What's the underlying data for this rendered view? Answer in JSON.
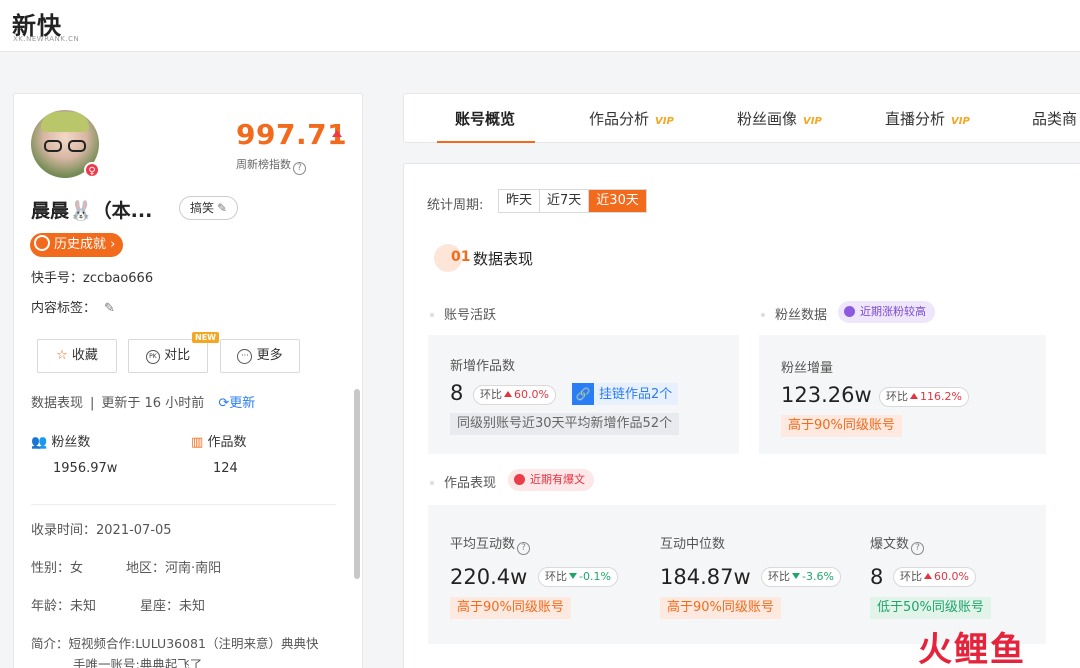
{
  "brand": {
    "logo": "新快",
    "sub": "XK.NEWRANK.CN"
  },
  "profile": {
    "score": "997.71",
    "score_label": "周新榜指数",
    "name": "晨晨🐰（本...",
    "tag": "搞笑",
    "gender": "♀",
    "history_label": "历史成就 ›",
    "kuaishou_id": "快手号：zccbao666",
    "content_tags": "内容标签：",
    "actions": {
      "collect": "收藏",
      "compare": "对比",
      "more": "更多",
      "new_badge": "NEW"
    },
    "data_perf": "数据表现",
    "updated": "更新于 16 小时前",
    "refresh": "更新",
    "fans_label": "粉丝数",
    "fans_value": "1956.97w",
    "works_label": "作品数",
    "works_value": "124",
    "indexed": "收录时间：2021-07-05",
    "gender_line": "性别：女",
    "region": "地区：河南·南阳",
    "age": "年龄：未知",
    "constellation": "星座：未知",
    "intro_1": "简介：短视频合作:LULU36081（注明来意）典典快",
    "intro_2": "手唯一账号:典典起飞了"
  },
  "tabs": [
    {
      "label": "账号概览"
    },
    {
      "label": "作品分析",
      "vip": "VIP"
    },
    {
      "label": "粉丝画像",
      "vip": "VIP"
    },
    {
      "label": "直播分析",
      "vip": "VIP"
    },
    {
      "label": "品类商"
    }
  ],
  "period": {
    "label": "统计周期:",
    "options": [
      "昨天",
      "近7天",
      "近30天"
    ]
  },
  "section": {
    "num": "01",
    "title": "数据表现"
  },
  "account_activity": {
    "title": "账号活跃",
    "label": "新增作品数",
    "value": "8",
    "ratio_prefix": "环比",
    "ratio": "60.0%",
    "link_chip": "挂链作品2个",
    "note": "同级别账号近30天平均新增作品52个"
  },
  "fans_data": {
    "title": "粉丝数据",
    "pill": "近期涨粉较高",
    "label": "粉丝增量",
    "value": "123.26w",
    "ratio_prefix": "环比",
    "ratio": "116.2%",
    "note": "高于90%同级账号"
  },
  "works_perf": {
    "title": "作品表现",
    "pill": "近期有爆文",
    "metrics": [
      {
        "label": "平均互动数",
        "value": "220.4w",
        "ratio_prefix": "环比",
        "ratio": "-0.1%",
        "note": "高于90%同级账号"
      },
      {
        "label": "互动中位数",
        "value": "184.87w",
        "ratio_prefix": "环比",
        "ratio": "-3.6%",
        "note": "高于90%同级账号"
      },
      {
        "label": "爆文数",
        "value": "8",
        "ratio_prefix": "环比",
        "ratio": "60.0%",
        "note": "低于50%同级账号"
      }
    ]
  },
  "watermark": "火鲤鱼"
}
